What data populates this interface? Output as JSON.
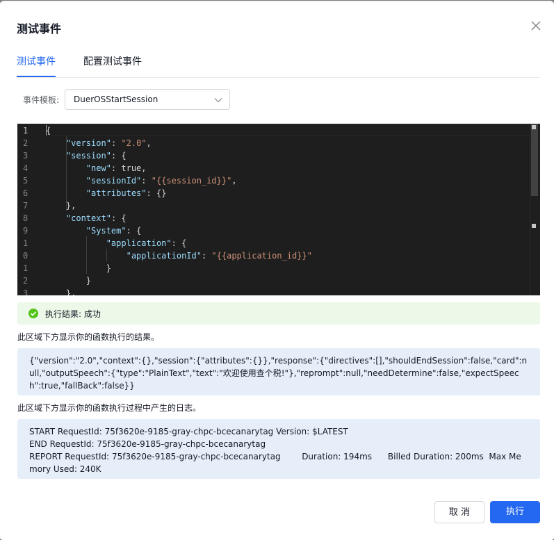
{
  "dialog": {
    "title": "测试事件",
    "close_icon": "close-icon"
  },
  "tabs": [
    {
      "label": "测试事件",
      "active": true
    },
    {
      "label": "配置测试事件",
      "active": false
    }
  ],
  "template": {
    "label": "事件模板:",
    "value": "DuerOSStartSession"
  },
  "editor": {
    "line_numbers": [
      "1",
      "2",
      "3",
      "4",
      "5",
      "6",
      "7",
      "8",
      "9",
      "1",
      "0",
      "1",
      "2",
      "3"
    ],
    "lines": [
      "{",
      "    \"version\": \"2.0\",",
      "    \"session\": {",
      "        \"new\": true,",
      "        \"sessionId\": \"{{session_id}}\",",
      "        \"attributes\": {}",
      "    },",
      "    \"context\": {",
      "        \"System\": {",
      "            \"application\": {",
      "                \"applicationId\": \"{{application_id}}\"",
      "            }",
      "        }",
      "    },"
    ]
  },
  "result": {
    "text": "执行结果: 成功",
    "status_color": "#52c41a"
  },
  "output": {
    "description": "此区域下方显示你的函数执行的结果。",
    "content": "{\"version\":\"2.0\",\"context\":{},\"session\":{\"attributes\":{}},\"response\":{\"directives\":[],\"shouldEndSession\":false,\"card\":null,\"outputSpeech\":{\"type\":\"PlainText\",\"text\":\"欢迎使用查个税!\"},\"reprompt\":null,\"needDetermine\":false,\"expectSpeech\":true,\"fallBack\":false}}"
  },
  "logs": {
    "description": "此区域下方显示你的函数执行过程中产生的日志。",
    "lines": [
      "START RequestId: 75f3620e-9185-gray-chpc-bcecanarytag Version: $LATEST",
      "END RequestId: 75f3620e-9185-gray-chpc-bcecanarytag",
      "REPORT RequestId: 75f3620e-9185-gray-chpc-bcecanarytag        Duration: 194ms      Billed Duration: 200ms  Max Memory Used: 240K"
    ]
  },
  "buttons": {
    "cancel": "取 消",
    "run": "执行"
  },
  "colors": {
    "accent": "#2468f2",
    "success_bg": "#ecf8e8",
    "info_bg": "#e6eef9"
  }
}
